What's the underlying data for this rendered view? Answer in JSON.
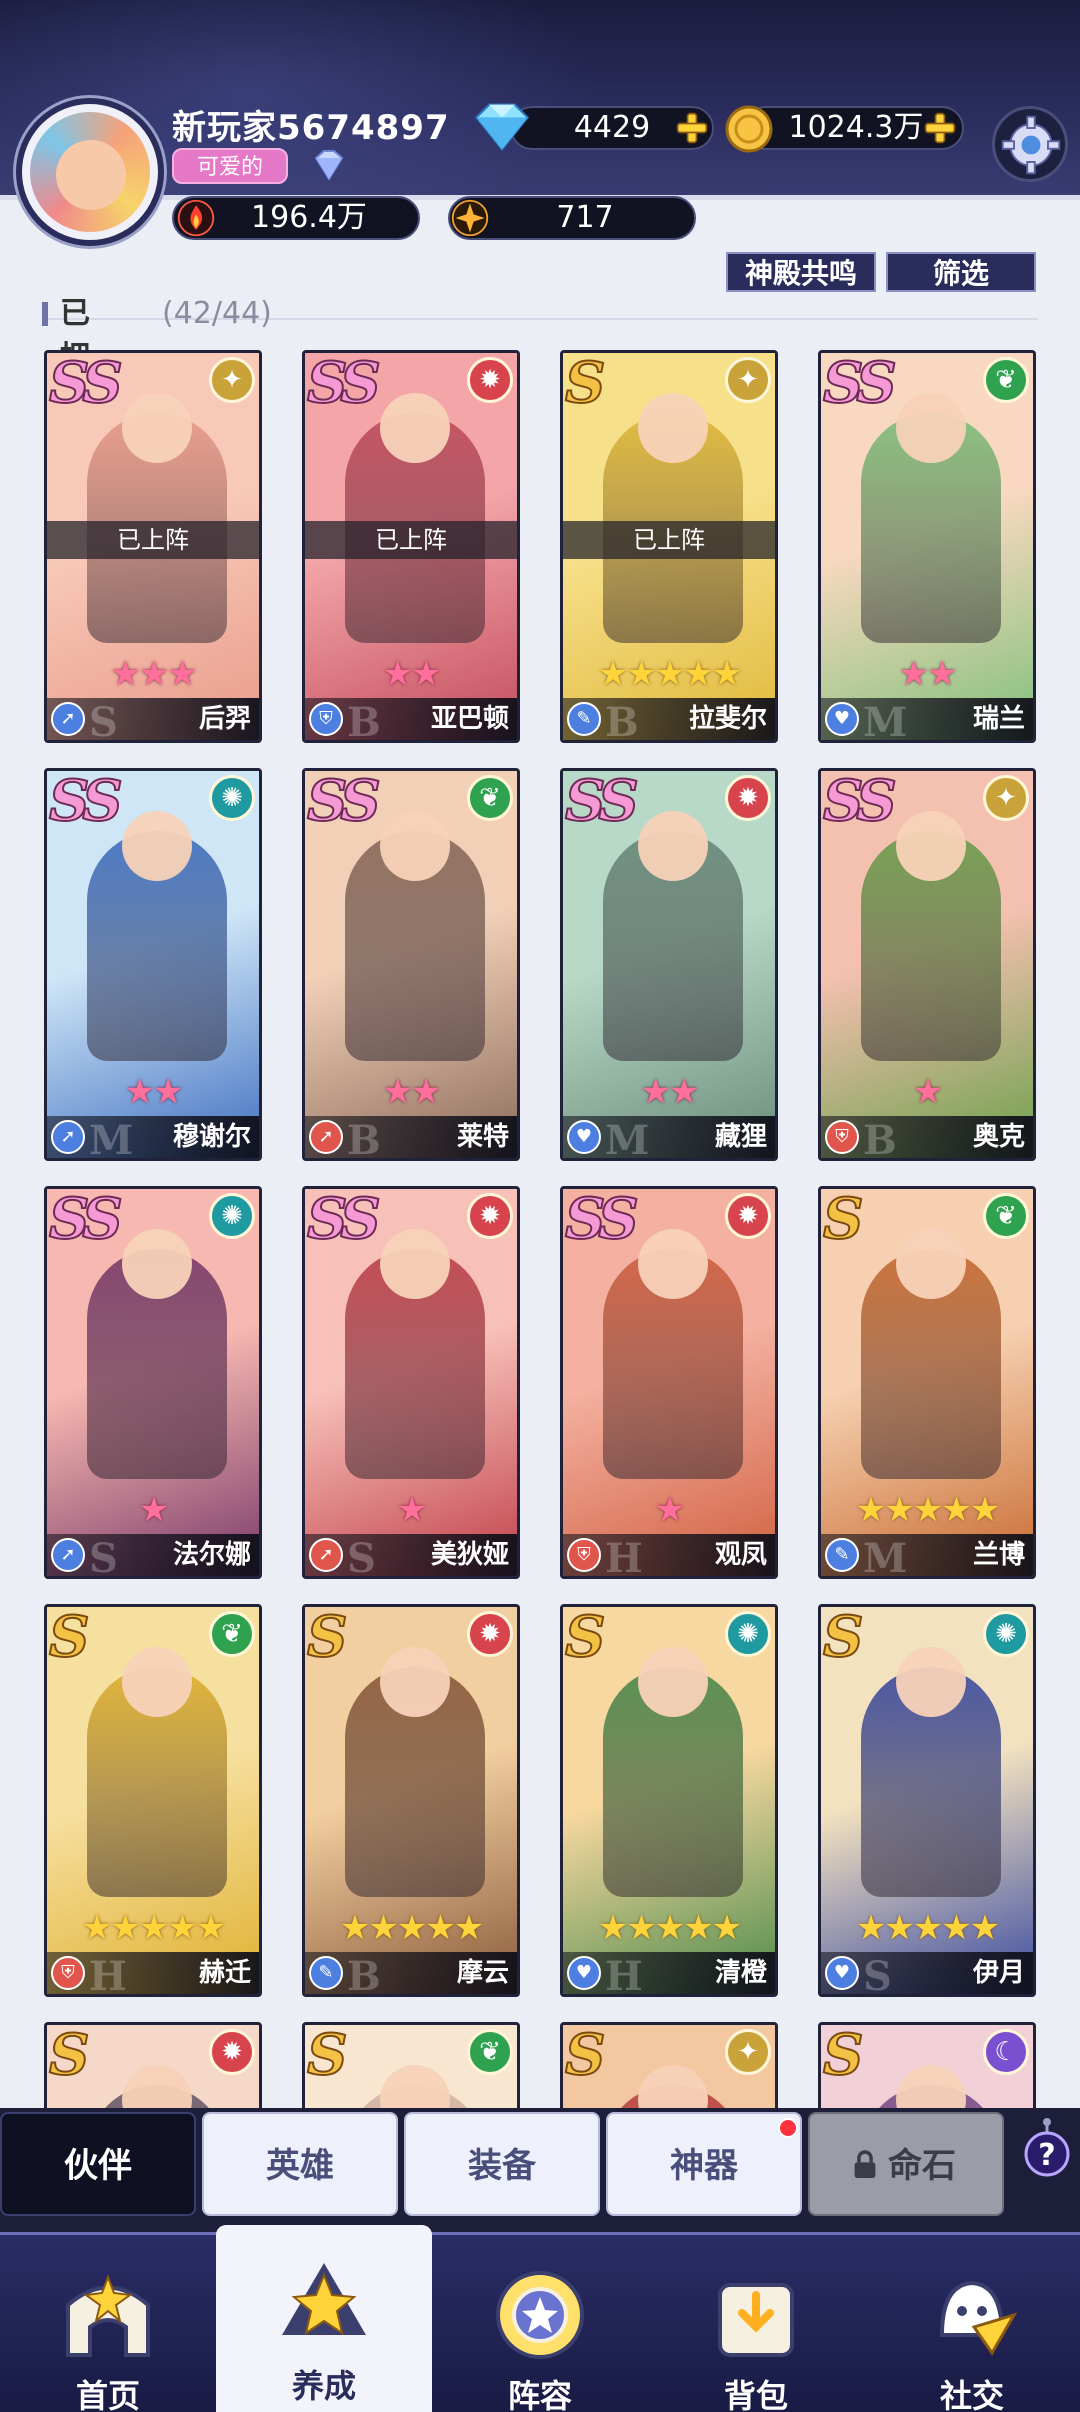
{
  "player": {
    "name": "新玩家5674897",
    "title_tag": "可爱的",
    "diamonds": "4429",
    "gold": "1024.3万",
    "power": "196.4万",
    "energy": "717"
  },
  "actions": {
    "resonance": "神殿共鸣",
    "filter": "筛选"
  },
  "owned": {
    "label": "已拥有",
    "count": "(42/44)"
  },
  "heroes": [
    {
      "name": "后羿",
      "rarity": "SS",
      "stars": 3,
      "star_color": "pink",
      "deployed": "已上阵",
      "element": "light",
      "class": "mage",
      "grade": "S"
    },
    {
      "name": "亚巴顿",
      "rarity": "SS",
      "stars": 2,
      "star_color": "pink",
      "deployed": "已上阵",
      "element": "fire",
      "class": "tank",
      "grade": "B"
    },
    {
      "name": "拉斐尔",
      "rarity": "S",
      "stars": 5,
      "star_color": "gold",
      "deployed": "已上阵",
      "element": "light",
      "class": "support",
      "grade": "B"
    },
    {
      "name": "瑞兰",
      "rarity": "SS",
      "stars": 2,
      "star_color": "pink",
      "deployed": "",
      "element": "nature",
      "class": "healer",
      "grade": "M"
    },
    {
      "name": "穆谢尔",
      "rarity": "SS",
      "stars": 2,
      "star_color": "pink",
      "deployed": "",
      "element": "wind",
      "class": "mage",
      "grade": "M"
    },
    {
      "name": "莱特",
      "rarity": "SS",
      "stars": 2,
      "star_color": "pink",
      "deployed": "",
      "element": "nature",
      "class": "assassin",
      "grade": "B"
    },
    {
      "name": "藏狸",
      "rarity": "SS",
      "stars": 2,
      "star_color": "pink",
      "deployed": "",
      "element": "fire",
      "class": "healer",
      "grade": "M"
    },
    {
      "name": "奥克",
      "rarity": "SS",
      "stars": 1,
      "star_color": "pink",
      "deployed": "",
      "element": "light",
      "class": "warrior",
      "grade": "B"
    },
    {
      "name": "法尔娜",
      "rarity": "SS",
      "stars": 1,
      "star_color": "pink",
      "deployed": "",
      "element": "wind",
      "class": "mage",
      "grade": "S"
    },
    {
      "name": "美狄娅",
      "rarity": "SS",
      "stars": 1,
      "star_color": "pink",
      "deployed": "",
      "element": "fire",
      "class": "assassin",
      "grade": "S"
    },
    {
      "name": "观凤",
      "rarity": "SS",
      "stars": 1,
      "star_color": "pink",
      "deployed": "",
      "element": "fire",
      "class": "warrior",
      "grade": "H"
    },
    {
      "name": "兰博",
      "rarity": "S",
      "stars": 5,
      "star_color": "gold",
      "deployed": "",
      "element": "nature",
      "class": "support",
      "grade": "M"
    },
    {
      "name": "赫迁",
      "rarity": "S",
      "stars": 5,
      "star_color": "gold",
      "deployed": "",
      "element": "nature",
      "class": "warrior",
      "grade": "H"
    },
    {
      "name": "摩云",
      "rarity": "S",
      "stars": 5,
      "star_color": "gold",
      "deployed": "",
      "element": "fire",
      "class": "support",
      "grade": "B"
    },
    {
      "name": "清橙",
      "rarity": "S",
      "stars": 5,
      "star_color": "gold",
      "deployed": "",
      "element": "wind",
      "class": "healer",
      "grade": "H"
    },
    {
      "name": "伊月",
      "rarity": "S",
      "stars": 5,
      "star_color": "gold",
      "deployed": "",
      "element": "wind",
      "class": "healer",
      "grade": "S"
    },
    {
      "name": "",
      "rarity": "S",
      "stars": 0,
      "star_color": "gold",
      "deployed": "",
      "element": "fire",
      "class": "",
      "grade": ""
    },
    {
      "name": "",
      "rarity": "S",
      "stars": 0,
      "star_color": "gold",
      "deployed": "",
      "element": "nature",
      "class": "",
      "grade": ""
    },
    {
      "name": "",
      "rarity": "S",
      "stars": 0,
      "star_color": "gold",
      "deployed": "",
      "element": "light",
      "class": "",
      "grade": ""
    },
    {
      "name": "",
      "rarity": "S",
      "stars": 0,
      "star_color": "gold",
      "deployed": "",
      "element": "moon",
      "class": "",
      "grade": ""
    }
  ],
  "subtabs": [
    {
      "label": "伙伴",
      "state": "active"
    },
    {
      "label": "英雄",
      "state": "normal"
    },
    {
      "label": "装备",
      "state": "normal"
    },
    {
      "label": "神器",
      "state": "normal",
      "badge": true
    },
    {
      "label": "命石",
      "state": "locked"
    }
  ],
  "help_label": "?",
  "nav": [
    {
      "label": "首页",
      "icon": "home-icon"
    },
    {
      "label": "养成",
      "icon": "star-crest-icon",
      "active": true
    },
    {
      "label": "阵容",
      "icon": "formation-icon"
    },
    {
      "label": "背包",
      "icon": "bag-icon"
    },
    {
      "label": "社交",
      "icon": "social-icon"
    }
  ],
  "colors": {
    "header_bg": "#1b1d3e",
    "accent": "#2a2c5c",
    "ss_pink": "#f59ad5",
    "s_gold": "#f3c143",
    "element_fire": "#d8444e",
    "element_nature": "#2fa24f",
    "element_wind": "#1f9aa0",
    "element_light": "#c9a23a",
    "element_moon": "#7a4fd0"
  }
}
